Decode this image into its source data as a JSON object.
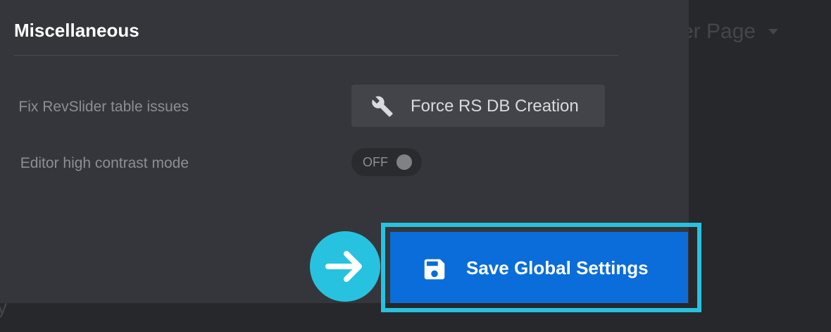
{
  "background": {
    "dropdown_text": "er Page",
    "fragment_text": "y"
  },
  "section": {
    "title": "Miscellaneous"
  },
  "settings": {
    "fix_table_label": "Fix RevSlider table issues",
    "force_db_button_label": "Force RS DB Creation",
    "force_db_button_icon": "wrench-icon",
    "contrast_label": "Editor high contrast mode",
    "contrast_toggle_state": "OFF"
  },
  "actions": {
    "save_label": "Save Global Settings",
    "save_icon": "floppy-disk-icon",
    "pointer_icon": "arrow-right-icon"
  },
  "colors": {
    "panel_bg": "#35363b",
    "page_bg": "#27282c",
    "save_button": "#0a6dd9",
    "highlight": "#27c2df"
  }
}
